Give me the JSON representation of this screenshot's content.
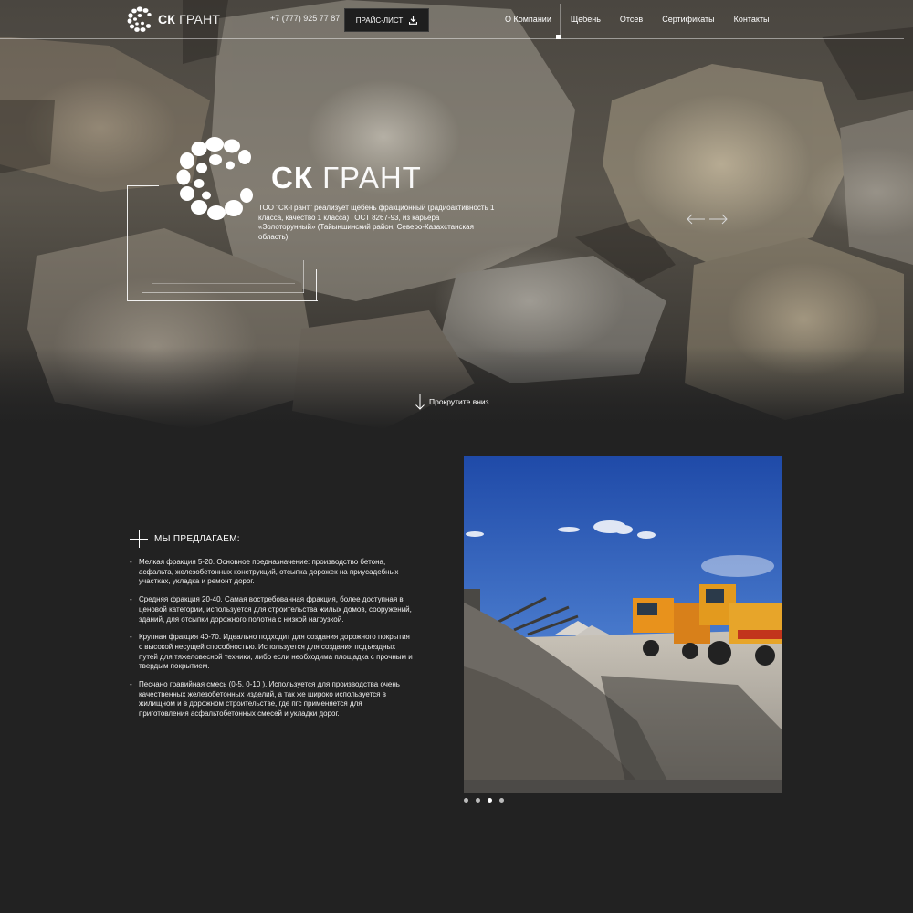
{
  "header": {
    "logo": {
      "bold": "СК",
      "light": "ГРАНТ"
    },
    "phone": "+7 (777) 925 77 87",
    "price_button": "ПРАЙС-ЛИСТ",
    "nav": [
      "О Компании",
      "Щебень",
      "Отсев",
      "Сертификаты",
      "Контакты"
    ]
  },
  "hero": {
    "title_bold": "СК",
    "title_light": "ГРАНТ",
    "description": "ТОО \"СК-Грант\" реализует щебень фракционный (радиоактивность 1 класса, качество 1 класса) ГОСТ 8267-93, из карьера «Золоторунный» (Тайыншинский район, Северо-Казахстанская область).",
    "scroll_label": "Прокрутите вниз"
  },
  "offer": {
    "title": "МЫ ПРЕДЛАГАЕМ:",
    "items": [
      "Мелкая фракция 5-20. Основное предназначение: производство бетона, асфальта, железобетонных конструкций, отсыпка дорожек на приусадебных участках, укладка и ремонт дорог.",
      "Средняя фракция 20-40. Самая востребованная фракция, более доступная в ценовой категории, используется для строительства жилых домов, сооружений, зданий, для отсыпки дорожного полотна с низкой нагрузкой.",
      "Крупная фракция 40-70. Идеально подходит для создания дорожного покрытия с высокой несущей способностью. Используется для создания подъездных путей для тяжеловесной техники, либо если необходима площадка с прочным и твердым покрытием.",
      "Песчано гравийная смесь (0-5, 0-10 ). Используется для производства очень качественных железобетонных изделий, а так же широко используется в жилищном и в дорожном строительстве, где пгс применяется для приготовления асфальтобетонных смесей и укладки дорог."
    ]
  },
  "slider": {
    "dots": 4,
    "active_dot": 3
  },
  "colors": {
    "background": "#222222",
    "text": "#ffffff",
    "button_bg": "#1e1e1e"
  }
}
